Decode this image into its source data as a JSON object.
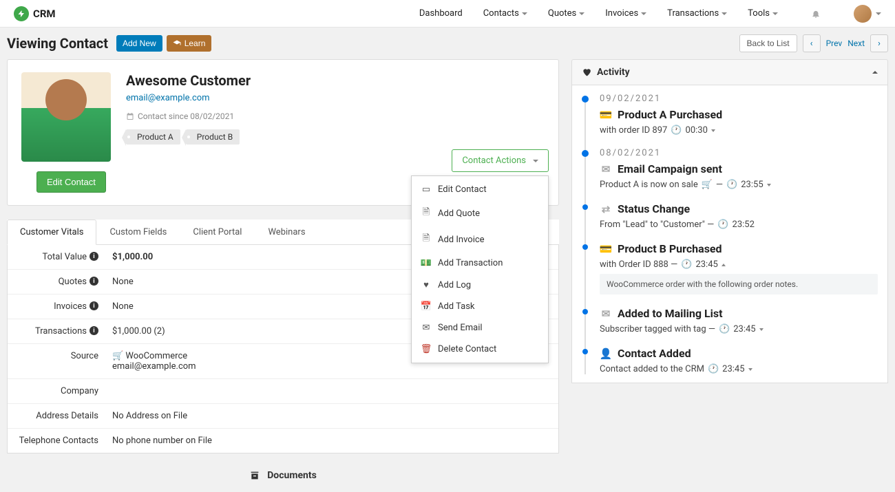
{
  "brand": "CRM",
  "nav": {
    "dashboard": "Dashboard",
    "contacts": "Contacts",
    "quotes": "Quotes",
    "invoices": "Invoices",
    "transactions": "Transactions",
    "tools": "Tools"
  },
  "subheader": {
    "title": "Viewing Contact",
    "add_new": "Add New",
    "learn": "Learn",
    "back_to_list": "Back to List",
    "prev": "Prev",
    "next": "Next"
  },
  "contact": {
    "name": "Awesome Customer",
    "email": "email@example.com",
    "since_label": "Contact since 08/02/2021",
    "tags": {
      "0": "Product A",
      "1": "Product B"
    },
    "edit_btn": "Edit Contact",
    "actions_label": "Contact Actions",
    "actions": {
      "edit": "Edit Contact",
      "add_quote": "Add Quote",
      "add_invoice": "Add Invoice",
      "add_transaction": "Add Transaction",
      "add_log": "Add Log",
      "add_task": "Add Task",
      "send_email": "Send Email",
      "delete": "Delete Contact"
    }
  },
  "tabs": {
    "vitals": "Customer Vitals",
    "custom": "Custom Fields",
    "portal": "Client Portal",
    "webinars": "Webinars"
  },
  "vitals": {
    "total_value": {
      "label": "Total Value",
      "value": "$1,000.00"
    },
    "quotes": {
      "label": "Quotes",
      "value": "None"
    },
    "invoices": {
      "label": "Invoices",
      "value": "None"
    },
    "transactions": {
      "label": "Transactions",
      "value": "$1,000.00 (2)"
    },
    "source": {
      "label": "Source",
      "value": "WooCommerce",
      "email": "email@example.com"
    },
    "company": {
      "label": "Company",
      "value": ""
    },
    "address": {
      "label": "Address Details",
      "value": "No Address on File"
    },
    "phone": {
      "label": "Telephone Contacts",
      "value": "No phone number on File"
    }
  },
  "documents_title": "Documents",
  "activity": {
    "heading": "Activity",
    "items": {
      "0": {
        "date": "09/02/2021",
        "title": "Product A Purchased",
        "meta_pre": "with order ID 897",
        "time": "00:30"
      },
      "1": {
        "date": "08/02/2021",
        "title": "Email Campaign sent",
        "meta_pre": "Product A is now on sale",
        "time": "23:55"
      },
      "2": {
        "title": "Status Change",
        "meta_pre": "From \"Lead\" to \"Customer\" —",
        "time": "23:52"
      },
      "3": {
        "title": "Product B Purchased",
        "meta_pre": "with Order ID 888 —",
        "time": "23:45",
        "note": "WooCommerce order with the following order notes."
      },
      "4": {
        "title": "Added to Mailing List",
        "meta_pre": "Subscriber tagged with tag —",
        "time": "23:45"
      },
      "5": {
        "title": "Contact Added",
        "meta_pre": "Contact added to the CRM",
        "time": "23:45"
      }
    }
  }
}
